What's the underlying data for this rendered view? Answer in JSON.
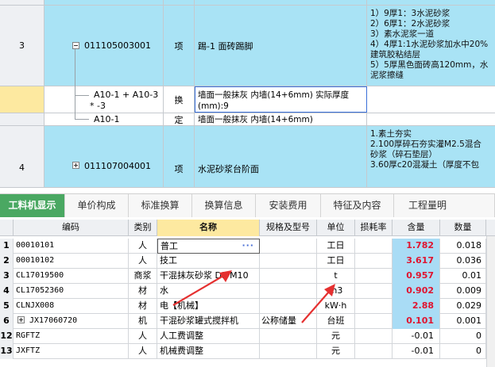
{
  "top_rows": [
    {
      "num": "3",
      "code": "011105003001",
      "type": "项",
      "name": "踢-1 面砖踢脚",
      "features": [
        "1）9厚1：3水泥砂浆",
        "2）6厚1：2水泥砂浆",
        "3）素水泥浆一道",
        "4）4厚1:1水泥砂浆加水中20%",
        "建筑胶粘结层",
        "5）5厚黑色面砖高120mm，水",
        "泥浆擦缝"
      ]
    },
    {
      "num": "",
      "code": "A10-1 + A10-3",
      "code2": "* -3",
      "type": "换",
      "name": "墙面一般抹灰 内墙(14+6mm)  实际厚度",
      "name2": "(mm):9"
    },
    {
      "num": "",
      "code": "A10-1",
      "type": "定",
      "name": "墙面一般抹灰 内墙(14+6mm)"
    },
    {
      "num": "4",
      "code": "011107004001",
      "type": "项",
      "name": "水泥砂浆台阶面",
      "features": [
        "1.素土夯实",
        "2.100厚碎石夯实灌M2.5混合",
        "砂浆（碎石垫层）",
        "3.60厚c20混凝土（厚度不包"
      ]
    }
  ],
  "tabs": [
    "工料机显示",
    "单价构成",
    "标准换算",
    "换算信息",
    "安装费用",
    "特征及内容",
    "工程量明"
  ],
  "grid_headers": [
    "编码",
    "类别",
    "名称",
    "规格及型号",
    "单位",
    "损耗率",
    "含量",
    "数量"
  ],
  "grid_rows": [
    {
      "rn": "1",
      "code": "00010101",
      "cat": "人",
      "name": "普工",
      "spec": "",
      "unit": "工日",
      "loss": "",
      "content": "1.782",
      "qty": "0.018"
    },
    {
      "rn": "2",
      "code": "00010102",
      "cat": "人",
      "name": "技工",
      "spec": "",
      "unit": "工日",
      "loss": "",
      "content": "3.617",
      "qty": "0.036"
    },
    {
      "rn": "3",
      "code": "CL17019500",
      "cat": "商浆",
      "name": "干混抹灰砂浆 DP M10",
      "spec": "",
      "unit": "t",
      "loss": "",
      "content": "0.957",
      "qty": "0.01"
    },
    {
      "rn": "4",
      "code": "CL17052360",
      "cat": "材",
      "name": "水",
      "spec": "",
      "unit": "m3",
      "loss": "",
      "content": "0.902",
      "qty": "0.009"
    },
    {
      "rn": "5",
      "code": "CLNJX008",
      "cat": "材",
      "name": "电【机械】",
      "spec": "",
      "unit": "kW·h",
      "loss": "",
      "content": "2.88",
      "qty": "0.029"
    },
    {
      "rn": "6",
      "code": "JX17060720",
      "cat": "机",
      "name": "干混砂浆罐式搅拌机",
      "spec": "公称储量",
      "unit": "台班",
      "loss": "",
      "content": "0.101",
      "qty": "0.001"
    },
    {
      "rn": "12",
      "code": "RGFTZ",
      "cat": "人",
      "name": "人工费调整",
      "spec": "",
      "unit": "元",
      "loss": "",
      "content": "-0.01",
      "qty": "0"
    },
    {
      "rn": "13",
      "code": "JXFTZ",
      "cat": "人",
      "name": "机械费调整",
      "spec": "",
      "unit": "元",
      "loss": "",
      "content": "-0.01",
      "qty": "0"
    }
  ],
  "colors": {
    "row_highlight": "#a9e3f5",
    "active_tab": "#4aa862",
    "content_text": "#e0142f",
    "arrow": "#e53030"
  }
}
